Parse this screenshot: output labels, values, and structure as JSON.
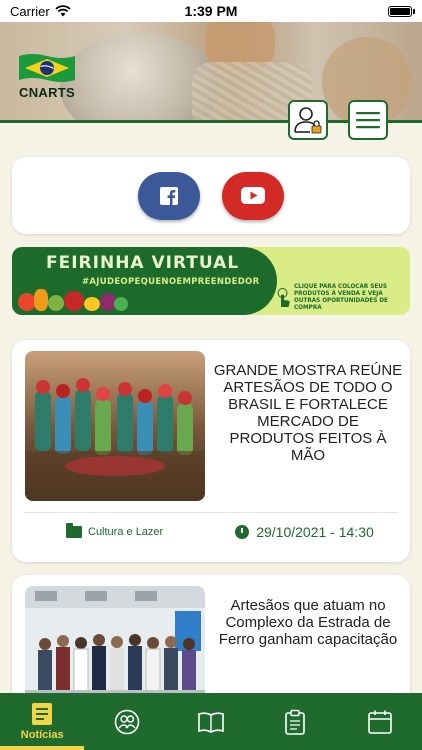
{
  "status_bar": {
    "carrier": "Carrier",
    "time": "1:39 PM"
  },
  "header": {
    "logo_text": "CNARTS"
  },
  "feirinha": {
    "title": "FEIRINHA VIRTUAL",
    "subtitle": "#AJUDEOPEQUENOEMPREENDEDOR",
    "cta": "CLIQUE PARA COLOCAR SEUS PRODUTOS À VENDA E VEJA OUTRAS OPORTUNIDADES DE COMPRA"
  },
  "news": [
    {
      "title": "GRANDE MOSTRA REÚNE ARTESÃOS DE TODO O BRASIL E FORTALECE MERCADO DE PRODUTOS FEITOS À MÃO",
      "category": "Cultura e Lazer",
      "date": "29/10/2021 - 14:30"
    },
    {
      "title": "Artesãos que atuam no Complexo da Estrada de Ferro ganham capacitação"
    }
  ],
  "tabbar": {
    "tabs": [
      {
        "label": "Notícias",
        "icon": "news-icon",
        "active": true
      },
      {
        "label": "",
        "icon": "artisans-icon"
      },
      {
        "label": "",
        "icon": "book-icon"
      },
      {
        "label": "",
        "icon": "clipboard-icon"
      },
      {
        "label": "",
        "icon": "calendar-icon"
      }
    ]
  },
  "colors": {
    "primary": "#1f6b2e",
    "accent": "#f1d44a",
    "background": "#f5f2e6",
    "facebook": "#3b5898",
    "youtube": "#d42a25"
  }
}
